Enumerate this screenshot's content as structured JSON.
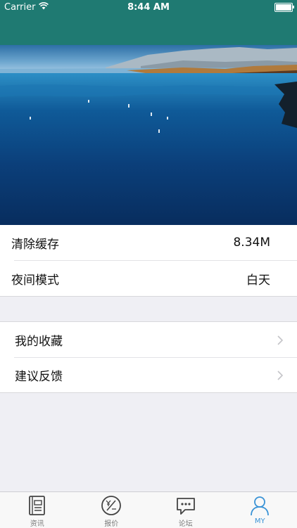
{
  "status_bar": {
    "carrier": "Carrier",
    "time": "8:44 AM"
  },
  "settings": [
    {
      "label": "清除缓存",
      "value": "8.34M"
    },
    {
      "label": "夜间模式",
      "value": "白天"
    }
  ],
  "menu": [
    {
      "label": "我的收藏"
    },
    {
      "label": "建议反馈"
    }
  ],
  "tabs": [
    {
      "label": "资讯",
      "icon": "news-icon"
    },
    {
      "label": "报价",
      "icon": "price-icon"
    },
    {
      "label": "论坛",
      "icon": "forum-icon"
    },
    {
      "label": "MY",
      "icon": "profile-icon",
      "active": true
    }
  ],
  "colors": {
    "nav": "#1f7a72",
    "active_tab": "#3a93d6",
    "background": "#efeff4"
  }
}
